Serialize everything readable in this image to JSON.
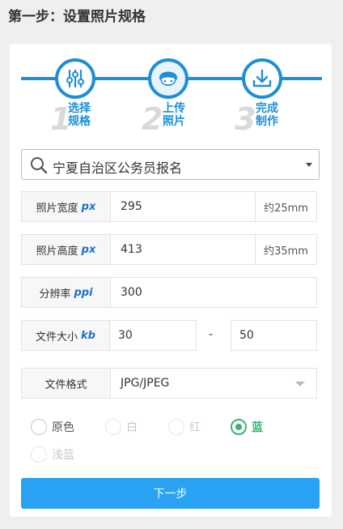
{
  "page": {
    "title": "第一步：设置照片规格"
  },
  "steps": [
    {
      "number": "1",
      "label_line1": "选择",
      "label_line2": "规格"
    },
    {
      "number": "2",
      "label_line1": "上传",
      "label_line2": "照片"
    },
    {
      "number": "3",
      "label_line1": "完成",
      "label_line2": "制作"
    }
  ],
  "spec_select": {
    "value": "宁夏自治区公务员报名"
  },
  "width_row": {
    "label": "照片宽度",
    "unit": "px",
    "value": "295",
    "suffix": "约25mm"
  },
  "height_row": {
    "label": "照片高度",
    "unit": "px",
    "value": "413",
    "suffix": "约35mm"
  },
  "resolution_row": {
    "label": "分辨率",
    "unit": "ppi",
    "value": "300"
  },
  "filesize_row": {
    "label": "文件大小",
    "unit": "kb",
    "min": "30",
    "separator": "-",
    "max": "50"
  },
  "format_row": {
    "label": "文件格式",
    "value": "JPG/JPEG"
  },
  "background_options": [
    {
      "label": "原色",
      "state": "enabled"
    },
    {
      "label": "白",
      "state": "disabled"
    },
    {
      "label": "红",
      "state": "disabled"
    },
    {
      "label": "蓝",
      "state": "checked"
    },
    {
      "label": "浅蓝",
      "state": "disabled"
    }
  ],
  "next_button": {
    "label": "下一步"
  },
  "colors": {
    "accent": "#1d8fd6",
    "button": "#2aa2f3",
    "radio_checked": "#3cb371",
    "unit_text": "#1d6fd6"
  }
}
